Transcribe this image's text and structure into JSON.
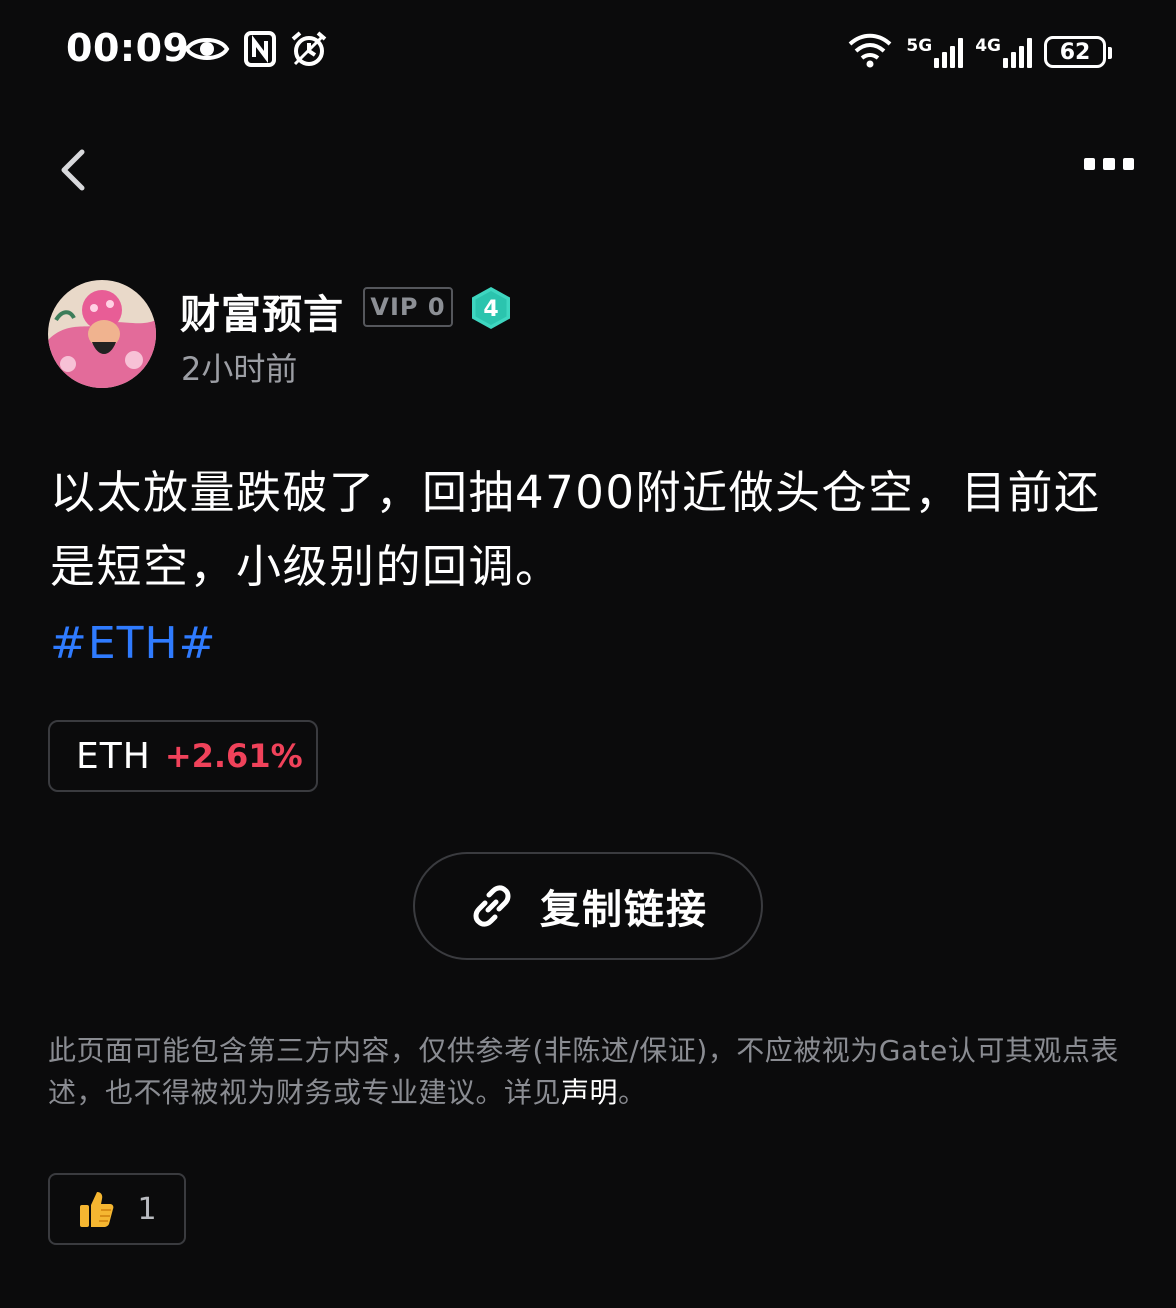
{
  "status_bar": {
    "time": "00:09",
    "net1": "5G",
    "net2": "4G",
    "battery": "62",
    "icons": [
      "eye-icon",
      "nfc-icon",
      "alarm-icon",
      "wifi-icon",
      "signal-icon",
      "battery-icon"
    ]
  },
  "nav": {
    "back_icon": "chevron-left-icon",
    "more_icon": "more-dots-icon"
  },
  "author": {
    "name": "财富预言",
    "vip": "VIP 0",
    "level": "4",
    "time": "2小时前",
    "level_color": "#3ed6c0"
  },
  "post": {
    "text": "以太放量跌破了，回抽4700附近做头仓空，目前还是短空，小级别的回调。",
    "hashtag": "#ETH#"
  },
  "coin": {
    "name": "ETH",
    "change": "+2.61%",
    "change_color": "#f0425a"
  },
  "actions": {
    "copy_link": "复制链接",
    "copy_icon": "link-icon"
  },
  "disclaimer": {
    "text": "此页面可能包含第三方内容，仅供参考(非陈述/保证)，不应被视为Gate认可其观点表述，也不得被视为财务或专业建议。详见",
    "link": "声明",
    "end": "。"
  },
  "reactions": {
    "like_icon": "thumbs-up-icon",
    "like_count": "1"
  }
}
